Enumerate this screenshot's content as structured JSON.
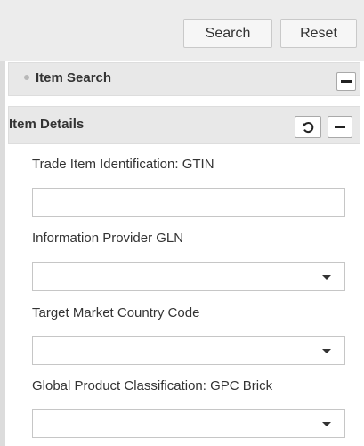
{
  "toolbar": {
    "search_label": "Search",
    "reset_label": "Reset"
  },
  "panels": {
    "item_search": {
      "title": "Item Search"
    },
    "item_details": {
      "title": "Item Details"
    }
  },
  "fields": [
    {
      "label": "Trade Item Identification: GTIN",
      "type": "text",
      "value": ""
    },
    {
      "label": "Information Provider GLN",
      "type": "select",
      "value": ""
    },
    {
      "label": "Target Market Country Code",
      "type": "select",
      "value": ""
    },
    {
      "label": "Global Product Classification: GPC Brick",
      "type": "select",
      "value": ""
    }
  ],
  "icons": {
    "collapse": "minus-icon",
    "reset": "refresh-icon",
    "dropdown": "chevron-down-icon",
    "bullet": "bullet-icon"
  },
  "colors": {
    "toolbar_bg": "#ececec",
    "panel_header_bg": "#e8e8e8",
    "field_border": "#c6c6c6",
    "text": "#333333"
  }
}
